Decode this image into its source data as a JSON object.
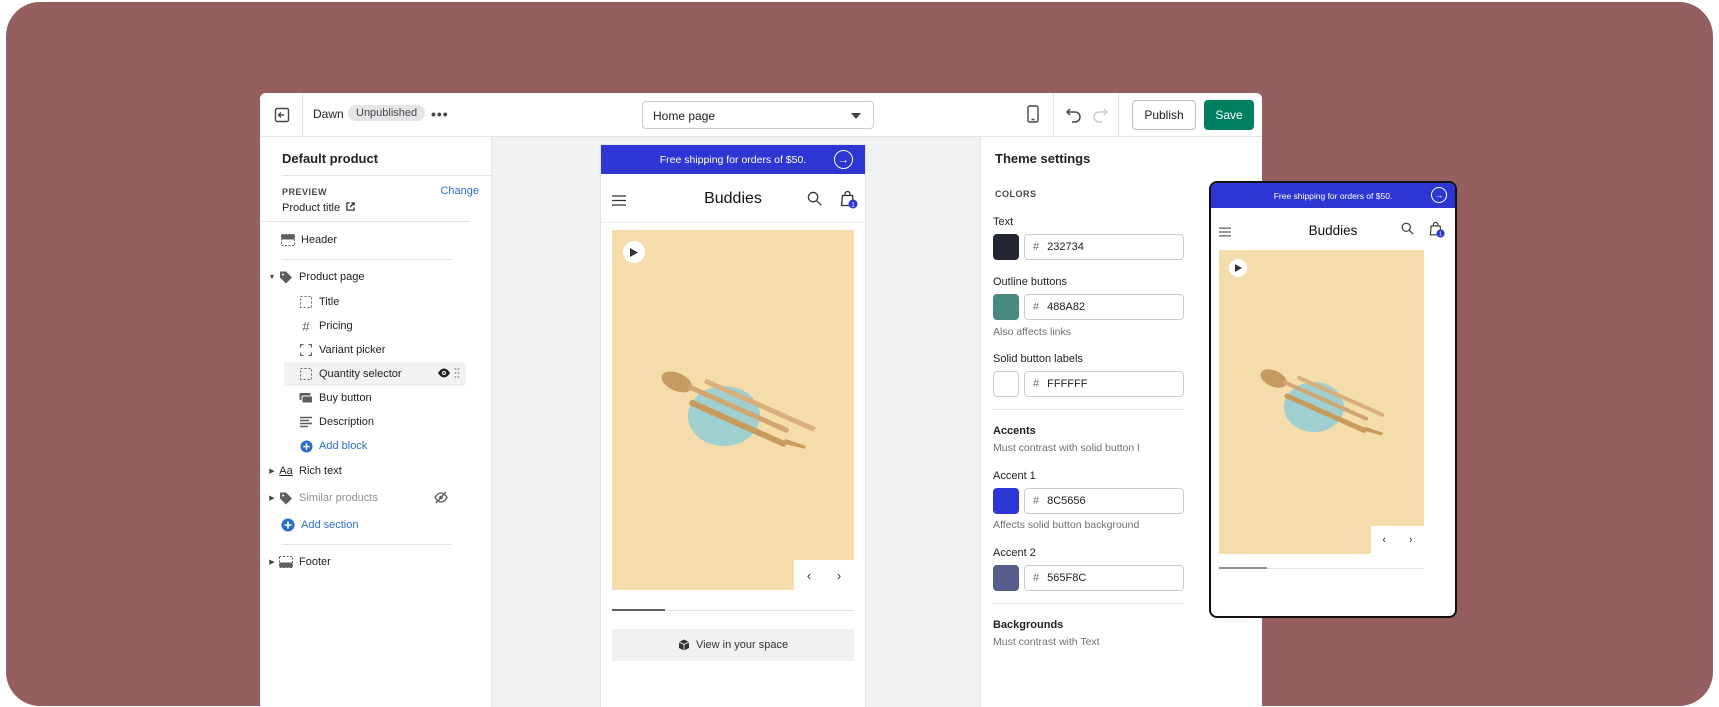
{
  "topbar": {
    "theme_name": "Dawn",
    "theme_status": "Unpublished",
    "more_label": "•••",
    "page_select": "Home page",
    "publish_label": "Publish",
    "save_label": "Save"
  },
  "left": {
    "title": "Default product",
    "preview_label": "PREVIEW",
    "preview_change": "Change",
    "preview_value": "Product title",
    "sections": {
      "header": "Header",
      "product_page": "Product page",
      "blocks": [
        "Title",
        "Pricing",
        "Variant picker",
        "Quantity selector",
        "Buy button",
        "Description"
      ],
      "add_block": "Add block",
      "rich_text": "Rich text",
      "similar_products": "Similar products",
      "add_section": "Add section",
      "footer": "Footer"
    }
  },
  "store": {
    "announcement": "Free shipping for orders of $50.",
    "name": "Buddies",
    "cart_count": "1",
    "view_in_space": "View in your space"
  },
  "right": {
    "title": "Theme settings",
    "colors_label": "COLORS",
    "text_label": "Text",
    "text_hex": "232734",
    "outline_label": "Outline buttons",
    "outline_hex": "488A82",
    "outline_help": "Also affects links",
    "solid_label": "Solid button labels",
    "solid_hex": "FFFFFF",
    "accents_heading": "Accents",
    "accents_help": "Must contrast with solid button l",
    "accent1_label": "Accent 1",
    "accent1_hex": "8C5656",
    "accent1_help": "Affects solid button background",
    "accent2_label": "Accent 2",
    "accent2_hex": "565F8C",
    "backgrounds_heading": "Backgrounds",
    "backgrounds_help": "Must contrast with Text"
  },
  "colors": {
    "backdrop": "#955f5f",
    "save_green": "#008060",
    "announcement_blue": "#2d35d2",
    "swatch_text": "#232734",
    "swatch_outline": "#488A82",
    "swatch_solid": "#FFFFFF",
    "swatch_accent1": "#2d35d2",
    "swatch_accent2": "#565F8C"
  }
}
